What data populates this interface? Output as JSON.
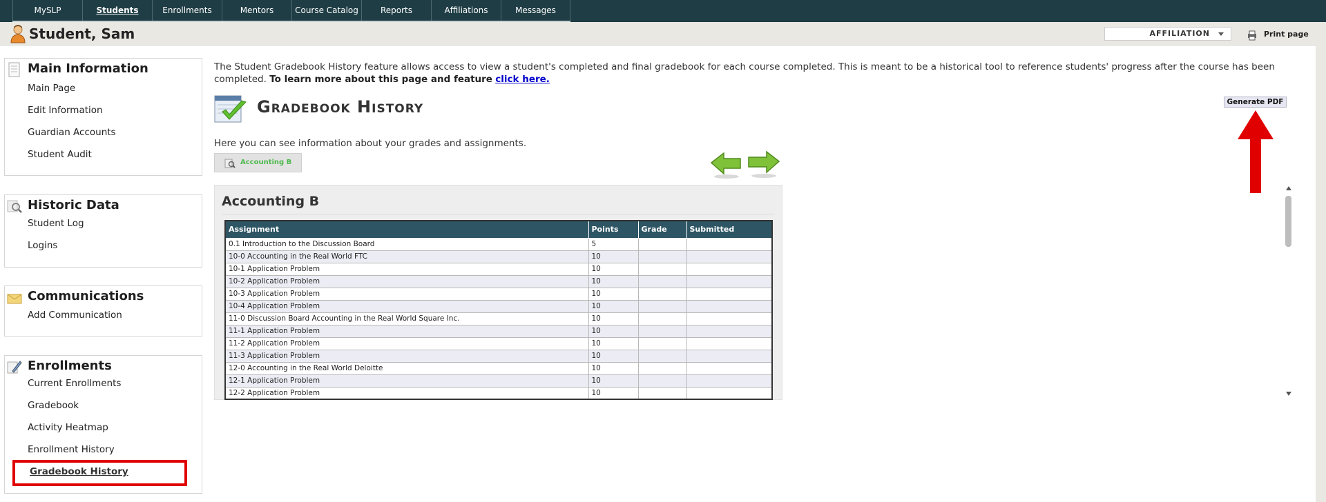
{
  "topnav": {
    "items": [
      {
        "label": "MySLP"
      },
      {
        "label": "Students"
      },
      {
        "label": "Enrollments"
      },
      {
        "label": "Mentors"
      },
      {
        "label": "Course Catalog"
      },
      {
        "label": "Reports"
      },
      {
        "label": "Affiliations"
      },
      {
        "label": "Messages"
      }
    ],
    "active": "Students"
  },
  "header": {
    "student_name": "Student, Sam",
    "affiliation_label": "AFFILIATION",
    "print_label": "Print page",
    "icons": [
      "person-icon",
      "printer-icon",
      "chevron-down-icon"
    ]
  },
  "sidebar": {
    "main_information": {
      "title": "Main Information",
      "icon": "document-icon",
      "links": [
        "Main Page",
        "Edit Information",
        "Guardian Accounts",
        "Student Audit"
      ]
    },
    "historic_data": {
      "title": "Historic Data",
      "icon": "magnifier-icon",
      "links": [
        "Student Log",
        "Logins"
      ]
    },
    "communications": {
      "title": "Communications",
      "icon": "envelope-icon",
      "links": [
        "Add Communication"
      ]
    },
    "enrollments": {
      "title": "Enrollments",
      "icon": "pencil-icon",
      "links": [
        "Current Enrollments",
        "Gradebook",
        "Activity Heatmap",
        "Enrollment History",
        "Gradebook History"
      ],
      "selected": "Gradebook History"
    }
  },
  "main": {
    "intro_text": "The Student Gradebook History feature allows access to view a student's completed and final gradebook for each course completed. This is meant to be a historical tool to reference students' progress after the course has been completed.",
    "intro_more": "To learn more about this page and feature",
    "intro_link": "click here.",
    "page_title": "Gradebook History",
    "generate_pdf_label": "Generate PDF",
    "subtitle": "Here you can see information about your grades and assignments.",
    "course_tab_label": "Accounting B",
    "course_title": "Accounting B",
    "accent_color": "#2d5564",
    "annotation_color": "#e00000",
    "table": {
      "headers": [
        "Assignment",
        "Points",
        "Grade",
        "Submitted"
      ],
      "rows": [
        [
          "0.1 Introduction to the Discussion Board",
          "5",
          "",
          ""
        ],
        [
          "10-0 Accounting in the Real World FTC",
          "10",
          "",
          ""
        ],
        [
          "10-1 Application Problem",
          "10",
          "",
          ""
        ],
        [
          "10-2 Application Problem",
          "10",
          "",
          ""
        ],
        [
          "10-3 Application Problem",
          "10",
          "",
          ""
        ],
        [
          "10-4 Application Problem",
          "10",
          "",
          ""
        ],
        [
          "11-0 Discussion Board Accounting in the Real World Square Inc.",
          "10",
          "",
          ""
        ],
        [
          "11-1 Application Problem",
          "10",
          "",
          ""
        ],
        [
          "11-2 Application Problem",
          "10",
          "",
          ""
        ],
        [
          "11-3 Application Problem",
          "10",
          "",
          ""
        ],
        [
          "12-0 Accounting in the Real World Deloitte",
          "10",
          "",
          ""
        ],
        [
          "12-1 Application Problem",
          "10",
          "",
          ""
        ],
        [
          "12-2 Application Problem",
          "10",
          "",
          ""
        ]
      ]
    }
  }
}
